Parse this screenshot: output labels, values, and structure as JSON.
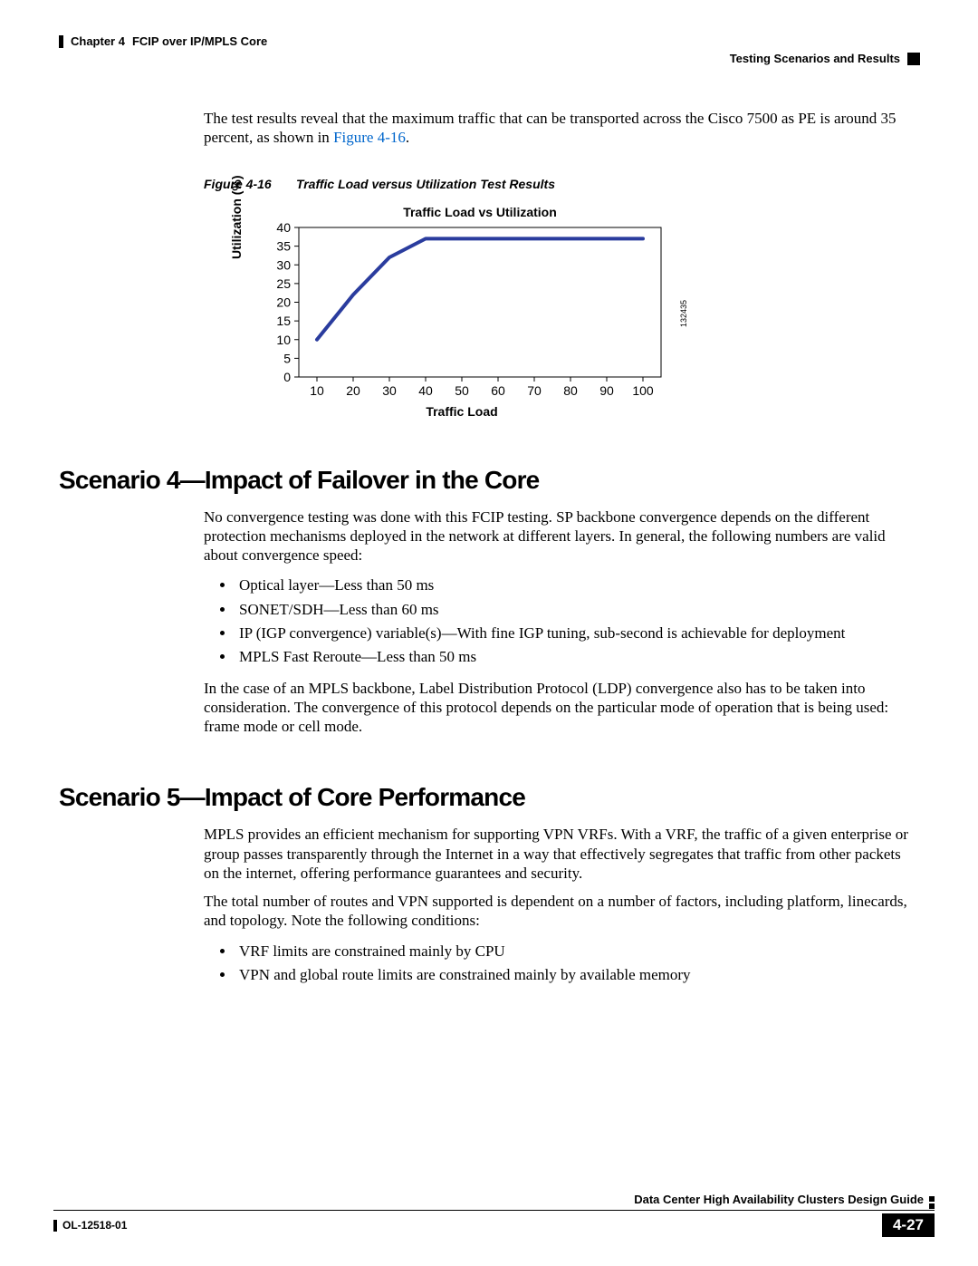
{
  "header": {
    "chapter": "Chapter 4",
    "chapter_title": "FCIP over IP/MPLS Core",
    "section_title": "Testing Scenarios and Results"
  },
  "intro_para_1": "The test results reveal that the maximum traffic that can be transported across the Cisco 7500 as PE is around 35 percent, as shown in ",
  "intro_link": "Figure 4-16",
  "intro_para_2": ".",
  "figure_caption_label": "Figure 4-16",
  "figure_caption_text": "Traffic Load versus Utilization Test Results",
  "chart_data": {
    "type": "line",
    "title": "Traffic Load vs Utilization",
    "xlabel": "Traffic Load",
    "ylabel": "Utilization (%)",
    "x": [
      10,
      20,
      30,
      40,
      50,
      60,
      70,
      80,
      90,
      100
    ],
    "values": [
      10,
      22,
      32,
      37,
      37,
      37,
      37,
      37,
      37,
      37
    ],
    "ylim": [
      0,
      40
    ],
    "xlim": [
      5,
      105
    ],
    "yticks": [
      0,
      5,
      10,
      15,
      20,
      25,
      30,
      35,
      40
    ],
    "side_id": "132435"
  },
  "h2_1": "Scenario 4—Impact of Failover in the Core",
  "s4_p1": "No convergence testing was done with this FCIP testing. SP backbone convergence depends on the different protection mechanisms deployed in the network at different layers. In general, the following numbers are valid about convergence speed:",
  "s4_bullets": [
    "Optical layer—Less than 50 ms",
    "SONET/SDH—Less than 60 ms",
    "IP (IGP convergence) variable(s)—With fine IGP tuning, sub-second is achievable for deployment",
    "MPLS Fast Reroute—Less than 50 ms"
  ],
  "s4_p2": "In the case of an MPLS backbone, Label Distribution Protocol (LDP) convergence also has to be taken into consideration. The convergence of this protocol depends on the particular mode of operation that is being used: frame mode or cell mode.",
  "h2_2": "Scenario 5—Impact of Core Performance",
  "s5_p1": "MPLS provides an efficient mechanism for supporting VPN VRFs. With a VRF, the traffic of a given enterprise or group passes transparently through the Internet in a way that effectively segregates that traffic from other packets on the internet, offering performance guarantees and security.",
  "s5_p2": "The total number of routes and VPN supported is dependent on a number of factors, including platform, linecards, and topology. Note the following conditions:",
  "s5_bullets": [
    "VRF limits are constrained mainly by CPU",
    "VPN and global route limits are constrained mainly by available memory"
  ],
  "footer": {
    "guide": "Data Center High Availability Clusters Design Guide",
    "docnum": "OL-12518-01",
    "pagenum": "4-27"
  }
}
